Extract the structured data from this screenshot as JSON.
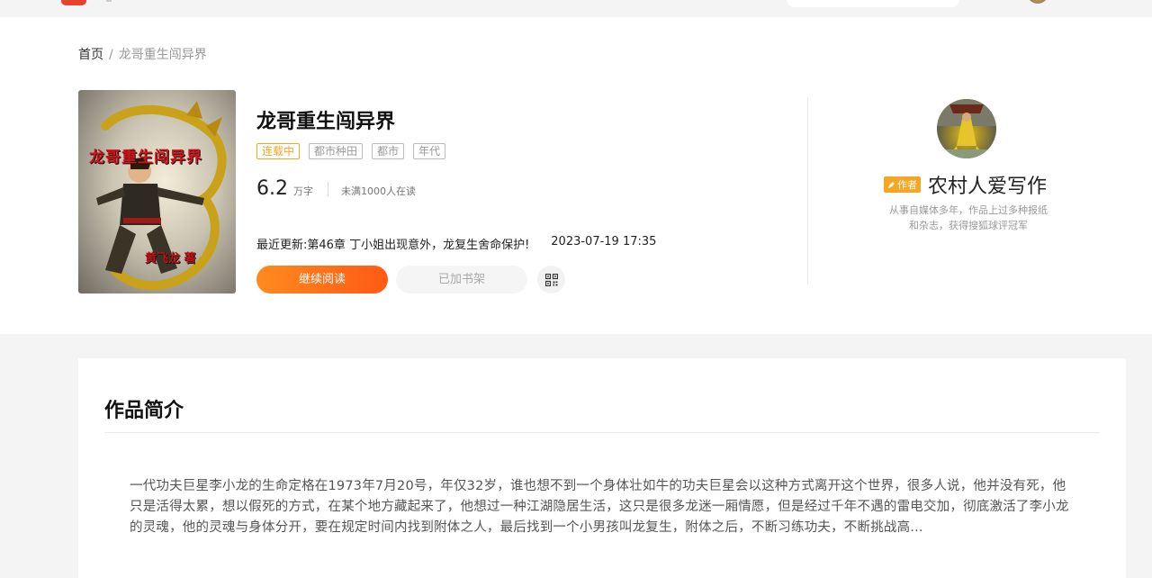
{
  "header": {
    "logo_icon": "app-logo-icon"
  },
  "breadcrumb": {
    "home": "首页",
    "separator": "/",
    "current": "龙哥重生闯异界"
  },
  "book": {
    "cover_title": "龙哥重生闯异界",
    "cover_author": "黄飞龙 著",
    "title": "龙哥重生闯异界",
    "tags": [
      "连载中",
      "都市种田",
      "都市",
      "年代"
    ],
    "word_count": "6.2",
    "word_unit": "万字",
    "readers": "未满1000人在读",
    "latest_label": "最近更新:",
    "latest_chapter": "第46章 丁小姐出现意外，龙复生舍命保护!",
    "latest_time": "2023-07-19 17:35",
    "read_button": "继续阅读",
    "shelf_button": "已加书架"
  },
  "author": {
    "badge": "作者",
    "name": "农村人爱写作",
    "bio": "从事自媒体多年，作品上过多种报纸和杂志，获得搜狐球评冠军"
  },
  "synopsis": {
    "heading": "作品简介",
    "text": "一代功夫巨星李小龙的生命定格在1973年7月20号，年仅32岁，谁也想不到一个身体壮如牛的功夫巨星会以这种方式离开这个世界，很多人说，他并没有死，他只是活得太累，想以假死的方式，在某个地方藏起来了，他想过一种江湖隐居生活，这只是很多龙迷一厢情愿，但是经过千年不遇的雷电交加，彻底激活了李小龙的灵魂，他的灵魂与身体分开，要在规定时间内找到附体之人，最后找到一个小男孩叫龙复生，附体之后，不断习练功夫，不断挑战高..."
  },
  "colors": {
    "accent": "#ff6a18",
    "status_tag": "#f5a623",
    "author_badge": "#f5a623"
  }
}
